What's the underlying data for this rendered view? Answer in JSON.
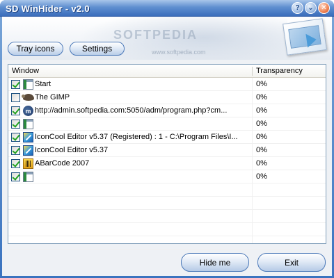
{
  "window": {
    "title": "SD WinHider - v2.0",
    "buttons": {
      "help": "?",
      "minimize": "⌄",
      "close": "✕"
    }
  },
  "banner": {
    "watermark": "SOFTPEDIA",
    "watermark_url": "www.softpedia.com"
  },
  "toolbar": {
    "tray_icons_label": "Tray icons",
    "settings_label": "Settings"
  },
  "list": {
    "columns": [
      "Window",
      "Transparency"
    ],
    "rows": [
      {
        "checked": true,
        "icon": "window-icon",
        "title": "Start",
        "transparency": "0%"
      },
      {
        "checked": false,
        "icon": "gimp-icon",
        "title": "The GIMP",
        "transparency": "0%"
      },
      {
        "checked": true,
        "icon": "mozilla-icon",
        "title": "http://admin.softpedia.com:5050/adm/program.php?cm...",
        "transparency": "0%"
      },
      {
        "checked": true,
        "icon": "window-icon",
        "title": "",
        "transparency": "0%"
      },
      {
        "checked": true,
        "icon": "iconcool-icon",
        "title": "IconCool Editor v5.37 (Registered) : 1 - C:\\Program Files\\I...",
        "transparency": "0%"
      },
      {
        "checked": true,
        "icon": "iconcool-icon",
        "title": "IconCool Editor v5.37",
        "transparency": "0%"
      },
      {
        "checked": true,
        "icon": "abarcode-icon",
        "title": "ABarCode 2007",
        "transparency": "0%"
      },
      {
        "checked": true,
        "icon": "window-icon",
        "title": "",
        "transparency": "0%"
      }
    ]
  },
  "footer": {
    "hide_label": "Hide me",
    "exit_label": "Exit"
  },
  "colors": {
    "titlebar": "#3a6dbb",
    "check": "#21a121",
    "button_border": "#4a78b8"
  }
}
